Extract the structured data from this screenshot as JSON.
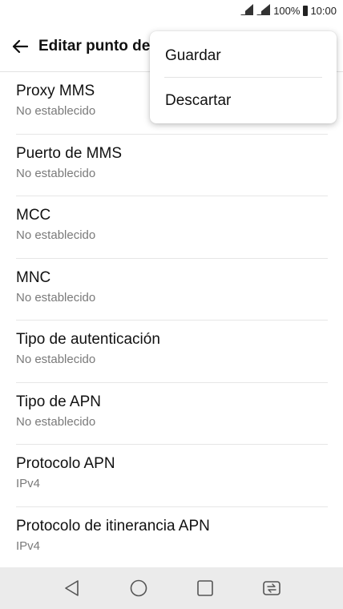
{
  "status_bar": {
    "battery": "100%",
    "time": "10:00"
  },
  "app_bar": {
    "back_icon": "arrow-left-icon",
    "title": "Editar punto de acceso"
  },
  "overflow_menu": {
    "items": [
      {
        "label": "Guardar"
      },
      {
        "label": "Descartar"
      }
    ]
  },
  "settings_list": [
    {
      "title": "Proxy MMS",
      "summary": "No establecido"
    },
    {
      "title": "Puerto de MMS",
      "summary": "No establecido"
    },
    {
      "title": "MCC",
      "summary": "No establecido"
    },
    {
      "title": "MNC",
      "summary": "No establecido"
    },
    {
      "title": "Tipo de autenticación",
      "summary": "No establecido"
    },
    {
      "title": "Tipo de APN",
      "summary": "No establecido"
    },
    {
      "title": "Protocolo APN",
      "summary": "IPv4"
    },
    {
      "title": "Protocolo de itinerancia APN",
      "summary": "IPv4"
    }
  ],
  "nav_bar": {
    "icons": [
      "back-triangle-icon",
      "home-circle-icon",
      "recents-square-icon",
      "dual-window-icon"
    ]
  }
}
